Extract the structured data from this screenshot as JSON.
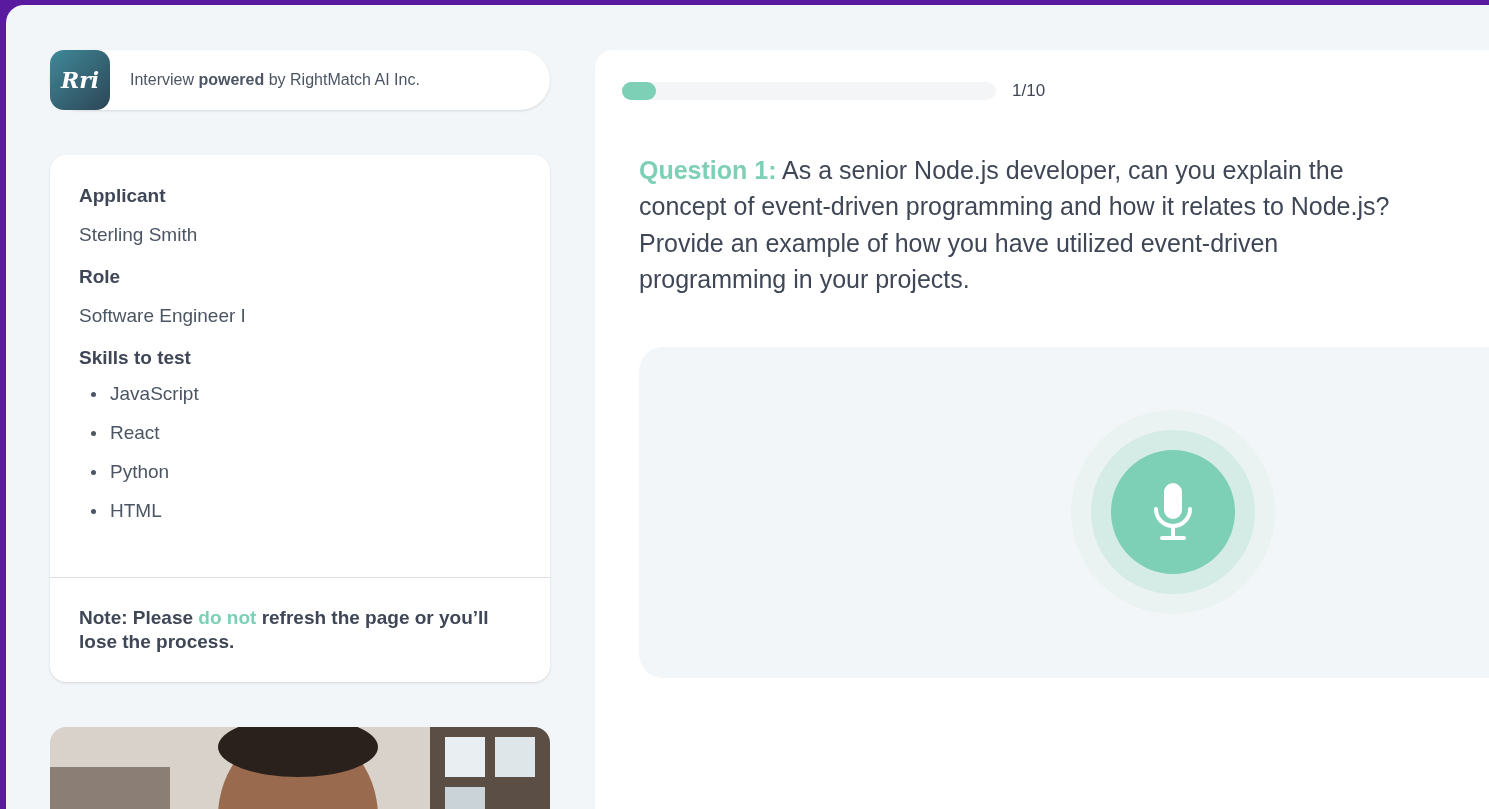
{
  "header": {
    "logo": "Rri",
    "text": "Interview **powered** by RightMatch AI Inc."
  },
  "details": [
    {
      "kind": "text",
      "label": "Applicant",
      "value": "Sterling Smith"
    },
    {
      "kind": "text",
      "label": "Role",
      "value": "Software Engineer I"
    },
    {
      "kind": "list",
      "label": "Skills to test",
      "items": [
        "JavaScript",
        "React",
        "Python",
        "HTML"
      ]
    }
  ],
  "note": [
    {
      "text": "Note: Please ",
      "highlight": false
    },
    {
      "text": "do not",
      "highlight": true
    },
    {
      "text": " refresh the page or you’ll lose the process.",
      "highlight": false
    }
  ],
  "progress": {
    "level": 0.09,
    "reading": "1/10"
  },
  "question": {
    "label": "Question 1:",
    "text": " As a senior Node.js developer, can you explain the concept of event-driven programming and how it relates to Node.js? Provide an example of how you have utilized event-driven programming in your projects."
  },
  "recorder": {
    "recording": false
  }
}
